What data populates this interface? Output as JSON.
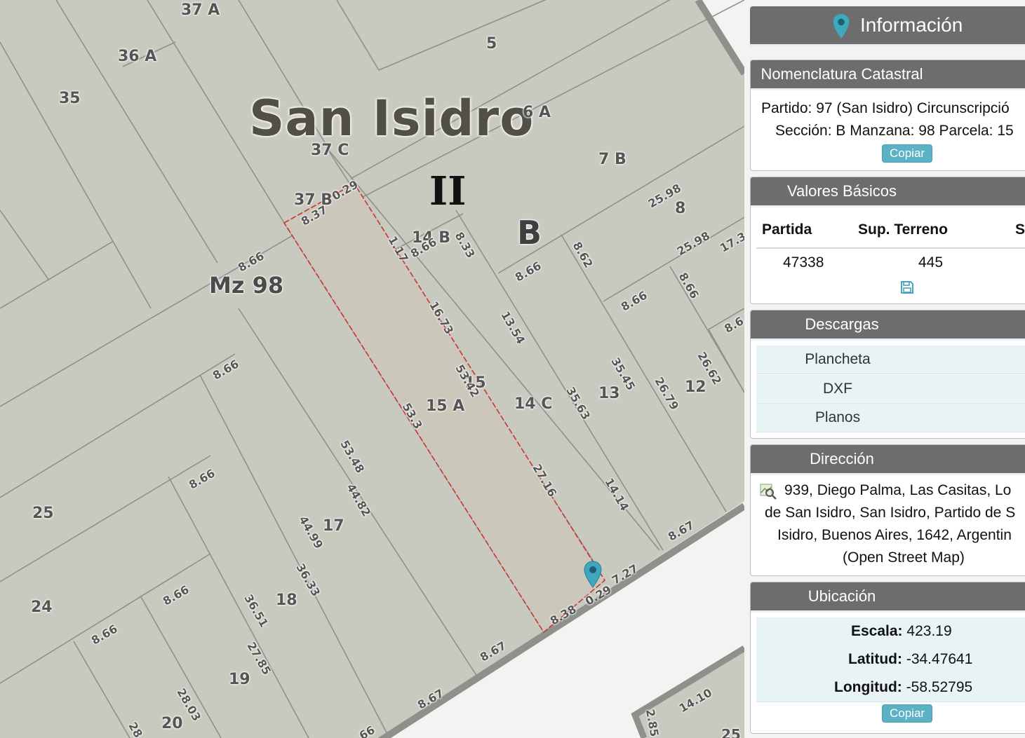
{
  "map": {
    "district_label": "San Isidro",
    "circunscripcion_label": "II",
    "seccion_label": "B",
    "manzana_label": "Mz 98",
    "lots": [
      "37 A",
      "36 A",
      "35",
      "5",
      "6 A",
      "37 C",
      "7 B",
      "37 B",
      "14 B",
      "15 A",
      "15",
      "14 C",
      "13",
      "12",
      "17",
      "18",
      "19",
      "20",
      "25",
      "24",
      "8"
    ],
    "dimensions": [
      "0.29",
      "8.37",
      "8.66",
      "1.17",
      "8.66",
      "8.33",
      "16.73",
      "53.42",
      "53.3",
      "27.16",
      "13.54",
      "35.63",
      "14.14",
      "35.45",
      "8.62",
      "8.66",
      "8.66",
      "25.98",
      "25.98",
      "17.3",
      "8.66",
      "26.62",
      "26.79",
      "8.6",
      "8.67",
      "8.66",
      "53.48",
      "44.82",
      "44.99",
      "36.33",
      "36.51",
      "27.85",
      "28.03",
      "28",
      "8.66",
      "8.66",
      "8.66",
      "8.67",
      "8.67",
      "8.38",
      "0.29",
      "7.27",
      "14.10",
      "2.85",
      "25",
      "66"
    ],
    "marker_icon": "map-pin-icon",
    "selected_parcel_color": "#cc3333"
  },
  "panel": {
    "title": "Información",
    "title_icon": "map-pin-icon",
    "nomenclatura": {
      "header": "Nomenclatura Catastral",
      "line1": "Partido: 97 (San Isidro) Circunscripció",
      "line2": "Sección: B Manzana: 98 Parcela: 15",
      "copy_label": "Copiar"
    },
    "valores": {
      "header": "Valores Básicos",
      "columns": [
        "Partida",
        "Sup. Terreno",
        "S"
      ],
      "values": [
        "47338",
        "445"
      ],
      "save_icon": "floppy-disk-icon"
    },
    "descargas": {
      "header": "Descargas",
      "items": [
        "Plancheta",
        "DXF",
        "Planos"
      ]
    },
    "direccion": {
      "header": "Dirección",
      "icon": "map-search-icon",
      "lines": [
        "939, Diego Palma, Las Casitas, Lo",
        "de San Isidro, San Isidro, Partido de S",
        "Isidro, Buenos Aires, 1642, Argentin",
        "(Open Street Map)"
      ]
    },
    "ubicacion": {
      "header": "Ubicación",
      "escala_label": "Escala:",
      "escala_value": "423.19",
      "latitud_label": "Latitud:",
      "latitud_value": "-34.47641",
      "longitud_label": "Longitud:",
      "longitud_value": "-58.52795",
      "copy_label": "Copiar"
    }
  },
  "colors": {
    "parcel_fill": "#c9cabf",
    "parcel_line": "#8f8f8c",
    "street": "#f3f3f2",
    "header_gray": "#6d6d6d",
    "accent": "#5bb1c5"
  }
}
